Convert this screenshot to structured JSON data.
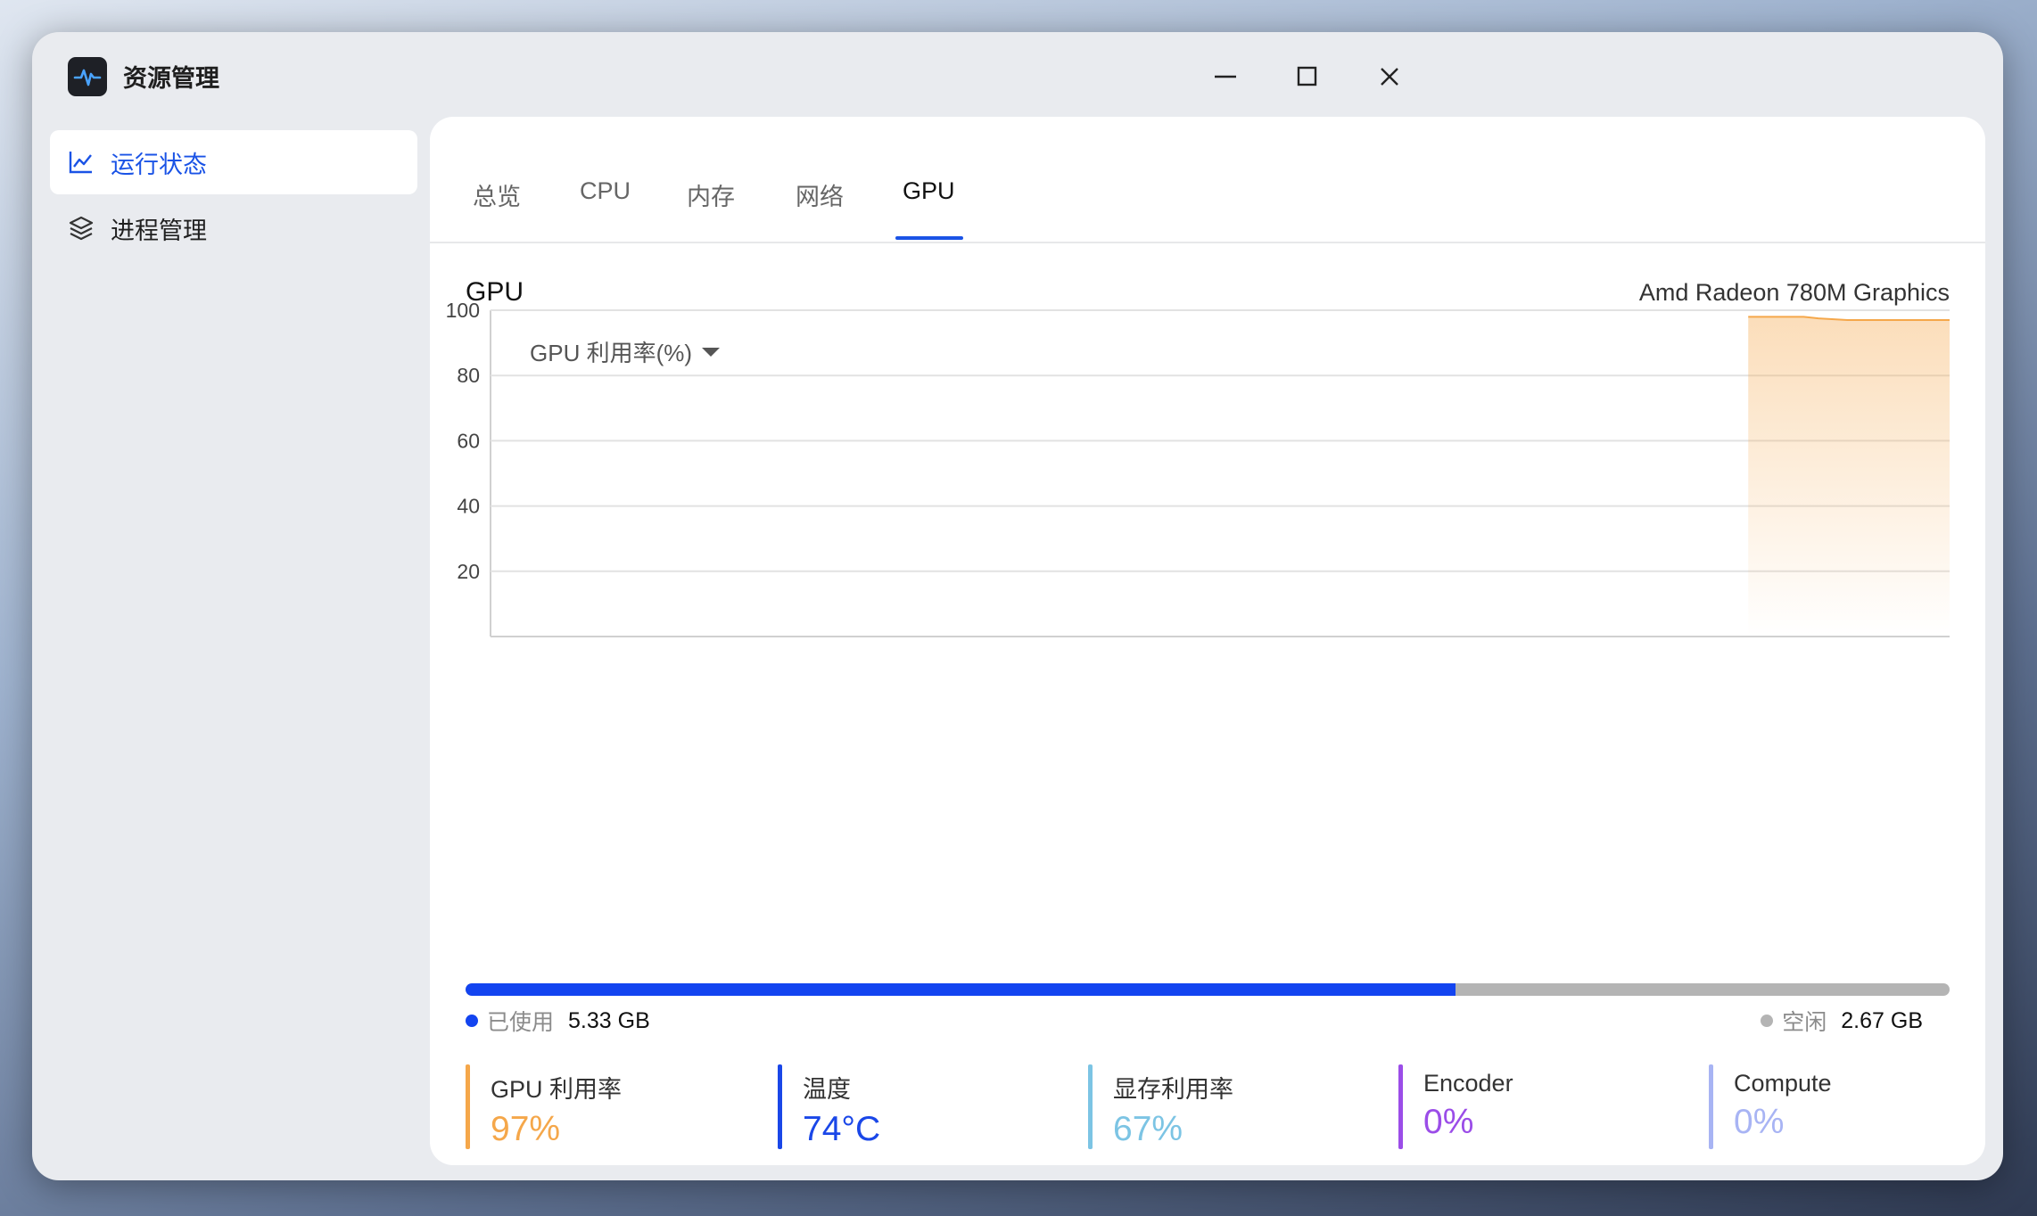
{
  "app": {
    "title": "资源管理"
  },
  "sidebar": {
    "items": [
      {
        "label": "运行状态",
        "active": true
      },
      {
        "label": "进程管理",
        "active": false
      }
    ]
  },
  "tabs": [
    {
      "label": "总览"
    },
    {
      "label": "CPU"
    },
    {
      "label": "内存"
    },
    {
      "label": "网络"
    },
    {
      "label": "GPU",
      "active": true
    }
  ],
  "section": {
    "title": "GPU",
    "device": "Amd Radeon 780M Graphics"
  },
  "metric_select": {
    "label": "GPU 利用率(%)"
  },
  "chart_data": {
    "type": "area",
    "y_ticks": [
      "100",
      "80",
      "60",
      "40",
      "20"
    ],
    "ylim": [
      0,
      100
    ],
    "grid": true,
    "color": "#f5a74a",
    "x": [
      0.862,
      0.9,
      0.91,
      0.93,
      1.0
    ],
    "xlim": [
      0,
      1
    ],
    "values": [
      98,
      98,
      97.5,
      97,
      97
    ]
  },
  "memory": {
    "used_label": "已使用",
    "used_value": "5.33 GB",
    "free_label": "空闲",
    "free_value": "2.67 GB",
    "used_fraction": 0.667,
    "used_color": "#1344f0",
    "free_color": "#b4b4b4"
  },
  "stats": [
    {
      "name": "GPU 利用率",
      "value": "97%",
      "color": "#f5a74a"
    },
    {
      "name": "温度",
      "value": "74°C",
      "color": "#1a47e8"
    },
    {
      "name": "显存利用率",
      "value": "67%",
      "color": "#7cc4e4"
    },
    {
      "name": "Encoder",
      "value": "0%",
      "color": "#9b4de8"
    },
    {
      "name": "Compute",
      "value": "0%",
      "color": "#a8b4f4"
    }
  ]
}
